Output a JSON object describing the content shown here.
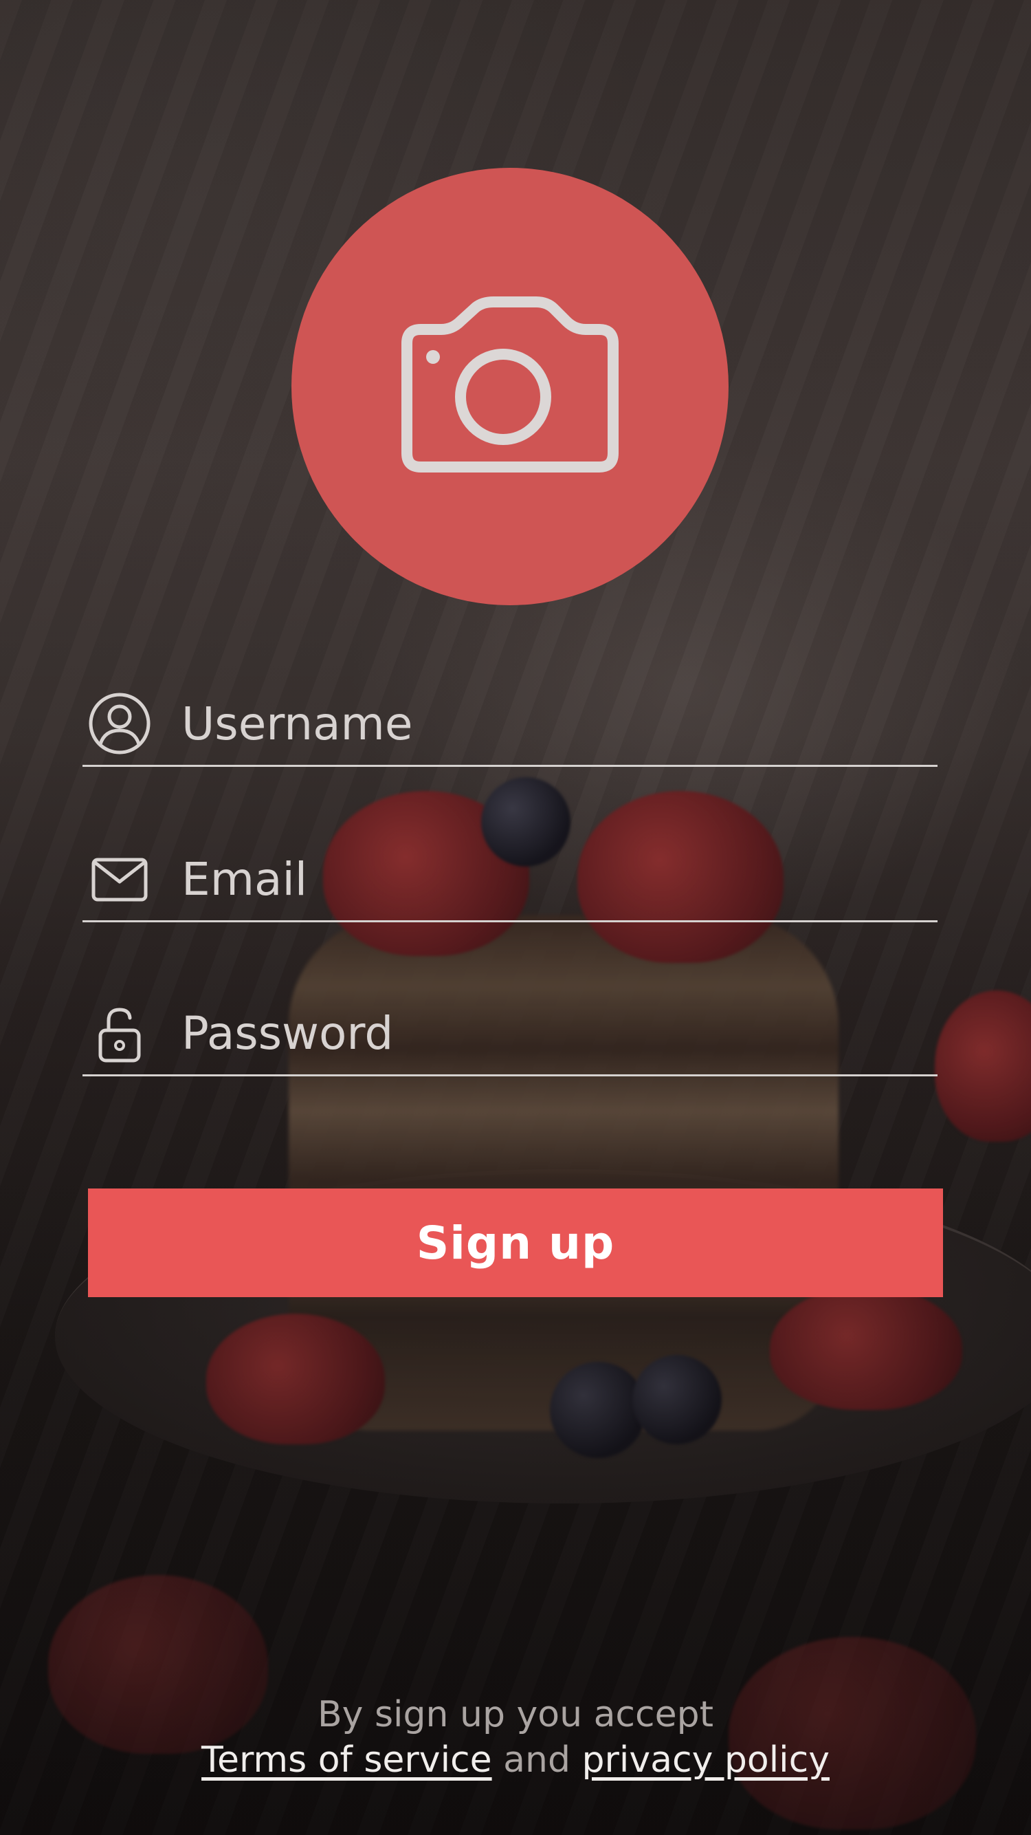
{
  "avatar": {
    "icon": "camera-icon",
    "color": "#cf5554"
  },
  "form": {
    "username": {
      "icon": "user-circle-icon",
      "placeholder": "Username",
      "value": ""
    },
    "email": {
      "icon": "mail-icon",
      "placeholder": "Email",
      "value": ""
    },
    "password": {
      "icon": "unlock-icon",
      "placeholder": "Password",
      "value": ""
    }
  },
  "signup_button": {
    "label": "Sign up",
    "color": "#e95656"
  },
  "footer": {
    "line1": "By sign up you accept",
    "terms_link": "Terms of service",
    "connector": "and",
    "privacy_link": "privacy policy"
  }
}
